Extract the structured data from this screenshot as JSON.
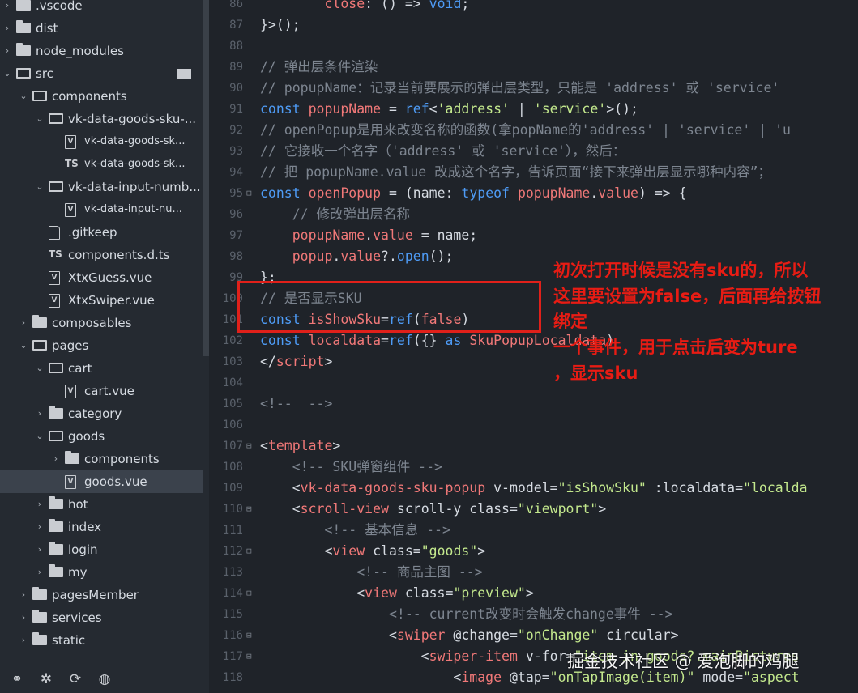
{
  "sidebar": {
    "tree": [
      {
        "label": ".vscode",
        "type": "folder",
        "depth": 0,
        "expanded": false
      },
      {
        "label": "dist",
        "type": "folder",
        "depth": 0,
        "expanded": false
      },
      {
        "label": "node_modules",
        "type": "folder",
        "depth": 0,
        "expanded": false
      },
      {
        "label": "src",
        "type": "folder",
        "depth": 0,
        "expanded": true
      },
      {
        "label": "components",
        "type": "folder",
        "depth": 1,
        "expanded": true
      },
      {
        "label": "vk-data-goods-sku-...",
        "type": "folder",
        "depth": 2,
        "expanded": true
      },
      {
        "label": "vk-data-goods-sk...",
        "type": "vue",
        "depth": 3
      },
      {
        "label": "vk-data-goods-sk...",
        "type": "ts",
        "depth": 3
      },
      {
        "label": "vk-data-input-numb...",
        "type": "folder",
        "depth": 2,
        "expanded": true
      },
      {
        "label": "vk-data-input-nu...",
        "type": "vue",
        "depth": 3
      },
      {
        "label": ".gitkeep",
        "type": "file",
        "depth": 2
      },
      {
        "label": "components.d.ts",
        "type": "ts",
        "depth": 2
      },
      {
        "label": "XtxGuess.vue",
        "type": "vue",
        "depth": 2
      },
      {
        "label": "XtxSwiper.vue",
        "type": "vue",
        "depth": 2
      },
      {
        "label": "composables",
        "type": "folder",
        "depth": 1,
        "expanded": false
      },
      {
        "label": "pages",
        "type": "folder",
        "depth": 1,
        "expanded": true
      },
      {
        "label": "cart",
        "type": "folder",
        "depth": 2,
        "expanded": true
      },
      {
        "label": "cart.vue",
        "type": "vue",
        "depth": 3
      },
      {
        "label": "category",
        "type": "folder",
        "depth": 2,
        "expanded": false
      },
      {
        "label": "goods",
        "type": "folder",
        "depth": 2,
        "expanded": true
      },
      {
        "label": "components",
        "type": "folder",
        "depth": 3,
        "expanded": false
      },
      {
        "label": "goods.vue",
        "type": "vue",
        "depth": 3,
        "selected": true
      },
      {
        "label": "hot",
        "type": "folder",
        "depth": 2,
        "expanded": false
      },
      {
        "label": "index",
        "type": "folder",
        "depth": 2,
        "expanded": false
      },
      {
        "label": "login",
        "type": "folder",
        "depth": 2,
        "expanded": false
      },
      {
        "label": "my",
        "type": "folder",
        "depth": 2,
        "expanded": false
      },
      {
        "label": "pagesMember",
        "type": "folder",
        "depth": 1,
        "expanded": false
      },
      {
        "label": "services",
        "type": "folder",
        "depth": 1,
        "expanded": false
      },
      {
        "label": "static",
        "type": "folder",
        "depth": 1,
        "expanded": false
      }
    ],
    "bottom_icons": [
      "binoculars-icon",
      "bug-icon",
      "git-icon",
      "palette-icon"
    ]
  },
  "editor": {
    "lines": [
      {
        "n": "86",
        "fold": "",
        "tokens": [
          [
            "        ",
            "punc"
          ],
          [
            "close",
            "var"
          ],
          [
            ": () => ",
            "punc"
          ],
          [
            "void",
            "kw"
          ],
          [
            ";",
            "punc"
          ]
        ]
      },
      {
        "n": "87",
        "fold": "",
        "tokens": [
          [
            "}>();",
            "punc"
          ]
        ]
      },
      {
        "n": "88",
        "fold": "",
        "tokens": []
      },
      {
        "n": "89",
        "fold": "",
        "tokens": [
          [
            "// 弹出层条件渲染",
            "cmt"
          ]
        ]
      },
      {
        "n": "90",
        "fold": "",
        "tokens": [
          [
            "// popupName：记录当前要展示的弹出层类型，只能是 'address' 或 'service'",
            "cmt"
          ]
        ]
      },
      {
        "n": "91",
        "fold": "",
        "tokens": [
          [
            "const ",
            "kw"
          ],
          [
            "popupName",
            "var"
          ],
          [
            " = ",
            "punc"
          ],
          [
            "ref",
            "fn"
          ],
          [
            "<",
            "punc"
          ],
          [
            "'address'",
            "str"
          ],
          [
            " | ",
            "punc"
          ],
          [
            "'service'",
            "str"
          ],
          [
            ">();",
            "punc"
          ]
        ]
      },
      {
        "n": "92",
        "fold": "",
        "tokens": [
          [
            "// openPopup是用来改变名称的函数(拿popName的'address' | 'service' | 'u",
            "cmt"
          ]
        ]
      },
      {
        "n": "93",
        "fold": "",
        "tokens": [
          [
            "// 它接收一个名字（'address' 或 'service'），然后：",
            "cmt"
          ]
        ]
      },
      {
        "n": "94",
        "fold": "",
        "tokens": [
          [
            "// 把 popupName.value 改成这个名字，告诉页面“接下来弹出层显示哪种内容”；",
            "cmt"
          ]
        ]
      },
      {
        "n": "95",
        "fold": "⊟",
        "tokens": [
          [
            "const ",
            "kw"
          ],
          [
            "openPopup",
            "var"
          ],
          [
            " = (",
            "punc"
          ],
          [
            "name",
            "punc"
          ],
          [
            ": ",
            "punc"
          ],
          [
            "typeof ",
            "kw"
          ],
          [
            "popupName",
            "var"
          ],
          [
            ".",
            "punc"
          ],
          [
            "value",
            "var"
          ],
          [
            ") => {",
            "punc"
          ]
        ]
      },
      {
        "n": "96",
        "fold": "",
        "tokens": [
          [
            "    ",
            "punc"
          ],
          [
            "// 修改弹出层名称",
            "cmt"
          ]
        ]
      },
      {
        "n": "97",
        "fold": "",
        "tokens": [
          [
            "    ",
            "punc"
          ],
          [
            "popupName",
            "var"
          ],
          [
            ".",
            "punc"
          ],
          [
            "value",
            "var"
          ],
          [
            " = name;",
            "punc"
          ]
        ]
      },
      {
        "n": "98",
        "fold": "",
        "tokens": [
          [
            "    ",
            "punc"
          ],
          [
            "popup",
            "var"
          ],
          [
            ".",
            "punc"
          ],
          [
            "value",
            "var"
          ],
          [
            "?.",
            "punc"
          ],
          [
            "open",
            "fn"
          ],
          [
            "();",
            "punc"
          ]
        ]
      },
      {
        "n": "99",
        "fold": "",
        "tokens": [
          [
            "};",
            "punc"
          ]
        ]
      },
      {
        "n": "100",
        "fold": "",
        "tokens": [
          [
            "// 是否显示SKU",
            "cmt"
          ]
        ]
      },
      {
        "n": "101",
        "fold": "",
        "tokens": [
          [
            "const ",
            "kw"
          ],
          [
            "isShowSku",
            "var"
          ],
          [
            "=",
            "punc"
          ],
          [
            "ref",
            "fn"
          ],
          [
            "(",
            "punc"
          ],
          [
            "false",
            "var"
          ],
          [
            ")",
            "punc"
          ]
        ]
      },
      {
        "n": "102",
        "fold": "",
        "tokens": [
          [
            "const ",
            "kw"
          ],
          [
            "localdata",
            "var"
          ],
          [
            "=",
            "punc"
          ],
          [
            "ref",
            "fn"
          ],
          [
            "({} ",
            "punc"
          ],
          [
            "as ",
            "kw"
          ],
          [
            "SkuPopupLocaldata",
            "var"
          ],
          [
            ")",
            "punc"
          ]
        ]
      },
      {
        "n": "103",
        "fold": "",
        "tokens": [
          [
            "</",
            "punc"
          ],
          [
            "script",
            "tag"
          ],
          [
            ">",
            "punc"
          ]
        ]
      },
      {
        "n": "104",
        "fold": "",
        "tokens": []
      },
      {
        "n": "105",
        "fold": "",
        "tokens": [
          [
            "<!--  -->",
            "cmt"
          ]
        ]
      },
      {
        "n": "106",
        "fold": "",
        "tokens": []
      },
      {
        "n": "107",
        "fold": "⊟",
        "tokens": [
          [
            "<",
            "punc"
          ],
          [
            "template",
            "tag"
          ],
          [
            ">",
            "punc"
          ]
        ]
      },
      {
        "n": "108",
        "fold": "",
        "tokens": [
          [
            "    ",
            "punc"
          ],
          [
            "<!-- SKU弹窗组件 -->",
            "cmt"
          ]
        ]
      },
      {
        "n": "109",
        "fold": "",
        "tokens": [
          [
            "    <",
            "punc"
          ],
          [
            "vk-data-goods-sku-popup",
            "tag"
          ],
          [
            " v-model=",
            "attr"
          ],
          [
            "\"isShowSku\"",
            "val"
          ],
          [
            " :localdata=",
            "attr"
          ],
          [
            "\"localda",
            "val"
          ]
        ]
      },
      {
        "n": "110",
        "fold": "⊟",
        "tokens": [
          [
            "    <",
            "punc"
          ],
          [
            "scroll-view",
            "tag"
          ],
          [
            " scroll-y class=",
            "attr"
          ],
          [
            "\"viewport\"",
            "val"
          ],
          [
            ">",
            "punc"
          ]
        ]
      },
      {
        "n": "111",
        "fold": "",
        "tokens": [
          [
            "        ",
            "punc"
          ],
          [
            "<!-- 基本信息 -->",
            "cmt"
          ]
        ]
      },
      {
        "n": "112",
        "fold": "⊟",
        "tokens": [
          [
            "        <",
            "punc"
          ],
          [
            "view",
            "tag"
          ],
          [
            " class=",
            "attr"
          ],
          [
            "\"goods\"",
            "val"
          ],
          [
            ">",
            "punc"
          ]
        ]
      },
      {
        "n": "113",
        "fold": "",
        "tokens": [
          [
            "            ",
            "punc"
          ],
          [
            "<!-- 商品主图 -->",
            "cmt"
          ]
        ]
      },
      {
        "n": "114",
        "fold": "⊟",
        "tokens": [
          [
            "            <",
            "punc"
          ],
          [
            "view",
            "tag"
          ],
          [
            " class=",
            "attr"
          ],
          [
            "\"preview\"",
            "val"
          ],
          [
            ">",
            "punc"
          ]
        ]
      },
      {
        "n": "115",
        "fold": "",
        "tokens": [
          [
            "                ",
            "punc"
          ],
          [
            "<!-- current改变时会触发change事件 -->",
            "cmt"
          ]
        ]
      },
      {
        "n": "116",
        "fold": "⊟",
        "tokens": [
          [
            "                <",
            "punc"
          ],
          [
            "swiper",
            "tag"
          ],
          [
            " @change=",
            "attr"
          ],
          [
            "\"onChange\"",
            "val"
          ],
          [
            " circular>",
            "attr"
          ]
        ]
      },
      {
        "n": "117",
        "fold": "⊟",
        "tokens": [
          [
            "                    <",
            "punc"
          ],
          [
            "swiper-item",
            "tag"
          ],
          [
            " v-for=",
            "attr"
          ],
          [
            "\"item in goods?.mainPictures",
            "val"
          ]
        ]
      },
      {
        "n": "118",
        "fold": "",
        "tokens": [
          [
            "                        <",
            "punc"
          ],
          [
            "image",
            "tag"
          ],
          [
            " @tap=",
            "attr"
          ],
          [
            "\"onTapImage(item)\"",
            "val"
          ],
          [
            " mode=",
            "attr"
          ],
          [
            "\"aspect",
            "val"
          ]
        ]
      }
    ]
  },
  "annotation": {
    "line1": "初次打开时候是没有sku的，所以",
    "line2": "这里要设置为false，后面再给按钮",
    "line3": "绑定",
    "line4": "一个事件，用于点击后变为ture",
    "line5": "，显示sku",
    "color": "#e81c14"
  },
  "watermark": "掘金技术社区 @ 爱泡脚的鸡腿"
}
